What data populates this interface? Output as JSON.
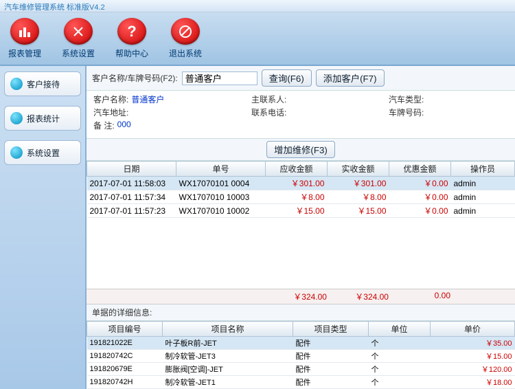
{
  "title": "汽车维修管理系统 标准版V4.2",
  "toolbar": {
    "report": "报表管理",
    "sysset": "系统设置",
    "help": "帮助中心",
    "exit": "退出系统"
  },
  "sidebar": {
    "reception": "客户接待",
    "stats": "报表统计",
    "settings": "系统设置"
  },
  "search": {
    "label": "客户名称/车牌号码(F2):",
    "value": "普通客户",
    "query_btn": "查询(F6)",
    "add_btn": "添加客户(F7)"
  },
  "info": {
    "name_lbl": "客户名称:",
    "name_val": "普通客户",
    "car_addr_lbl": "汽车地址:",
    "car_addr_val": "",
    "note_lbl": "备    注:",
    "note_val": "000",
    "contact_lbl": "主联系人:",
    "contact_val": "",
    "phone_lbl": "联系电话:",
    "phone_val": "",
    "car_type_lbl": "汽车类型:",
    "car_type_val": "",
    "plate_lbl": "车牌号码:",
    "plate_val": ""
  },
  "add_repair_btn": "增加维修(F3)",
  "grid1": {
    "headers": {
      "date": "日期",
      "billno": "单号",
      "due": "应收金额",
      "paid": "实收金额",
      "disc": "优惠金额",
      "op": "操作员"
    },
    "rows": [
      {
        "date": "2017-07-01 11:58:03",
        "billno": "WX17070101 0004",
        "due": "￥301.00",
        "paid": "￥301.00",
        "disc": "￥0.00",
        "op": "admin"
      },
      {
        "date": "2017-07-01 11:57:34",
        "billno": "WX1707010 10003",
        "due": "￥8.00",
        "paid": "￥8.00",
        "disc": "￥0.00",
        "op": "admin"
      },
      {
        "date": "2017-07-01 11:57:23",
        "billno": "WX1707010 10002",
        "due": "￥15.00",
        "paid": "￥15.00",
        "disc": "￥0.00",
        "op": "admin"
      }
    ]
  },
  "totals": {
    "due": "￥324.00",
    "paid": "￥324.00",
    "disc": "0.00"
  },
  "detail_title": "单据的详细信息:",
  "grid2": {
    "headers": {
      "code": "项目编号",
      "name": "项目名称",
      "type": "项目类型",
      "unit": "单位",
      "price": "单价"
    },
    "rows": [
      {
        "code": "191821022E",
        "name": "叶子板R前-JET",
        "type": "配件",
        "unit": "个",
        "price": "￥35.00"
      },
      {
        "code": "191820742C",
        "name": "制冷软管-JET3",
        "type": "配件",
        "unit": "个",
        "price": "￥15.00"
      },
      {
        "code": "191820679E",
        "name": "膨胀阀[空调]-JET",
        "type": "配件",
        "unit": "个",
        "price": "￥120.00"
      },
      {
        "code": "191820742H",
        "name": "制冷软管-JET1",
        "type": "配件",
        "unit": "个",
        "price": "￥18.00"
      }
    ]
  }
}
